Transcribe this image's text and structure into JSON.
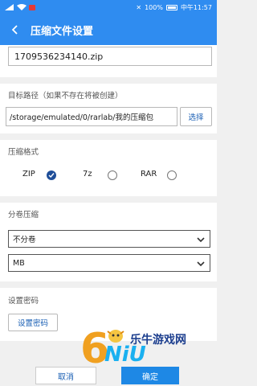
{
  "status_bar": {
    "battery": "100%",
    "time": "中午11:57"
  },
  "header": {
    "title": "压缩文件设置"
  },
  "filename": {
    "value": "1709536234140.zip"
  },
  "target": {
    "label": "目标路径（如果不存在将被创建）",
    "path": "/storage/emulated/0/rarlab/我的压缩包",
    "select_label": "选择"
  },
  "format": {
    "label": "压缩格式",
    "options": [
      "ZIP",
      "7z",
      "RAR"
    ],
    "selected": "ZIP"
  },
  "split": {
    "label": "分卷压缩",
    "mode": "不分卷",
    "unit": "MB"
  },
  "password": {
    "label": "设置密码",
    "button_label": "设置密码"
  },
  "footer": {
    "cancel_label": "取消",
    "ok_label": "确定"
  },
  "watermark": {
    "text": "乐牛游戏网"
  },
  "colors": {
    "primary": "#2f8cf0",
    "accent": "#1e88e5",
    "radio_on": "#1f4e99"
  }
}
